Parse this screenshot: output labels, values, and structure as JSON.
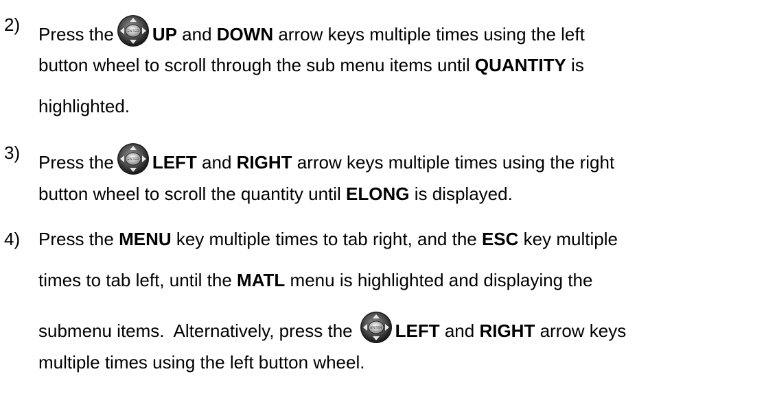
{
  "steps": [
    {
      "number": "2)",
      "lines": [
        [
          "Press the",
          "",
          "UP",
          " and ",
          "DOWN",
          " arrow keys multiple times using the left"
        ],
        [
          "button wheel to scroll through the sub menu items until ",
          "QUANTITY",
          " is"
        ],
        [
          "highlighted."
        ]
      ]
    },
    {
      "number": "3)",
      "lines": [
        [
          "Press the",
          "",
          "LEFT",
          " and ",
          "RIGHT",
          " arrow keys multiple times using the right"
        ],
        [
          "button wheel to scroll the quantity until ",
          "ELONG",
          " is displayed."
        ]
      ]
    },
    {
      "number": "4)",
      "lines": [
        [
          "Press the ",
          "MENU",
          " key multiple times to tab right, and the ",
          "ESC",
          " key multiple"
        ],
        [
          "times to tab left, until the ",
          "MATL",
          " menu is highlighted and displaying the"
        ],
        [
          "submenu items.  Alternatively, press the",
          "",
          "LEFT",
          " and ",
          "RIGHT",
          " arrow keys"
        ],
        [
          "multiple times using the left button wheel."
        ]
      ]
    }
  ],
  "icon": {
    "name": "enter-wheel-icon",
    "center_label": "ENTER"
  }
}
